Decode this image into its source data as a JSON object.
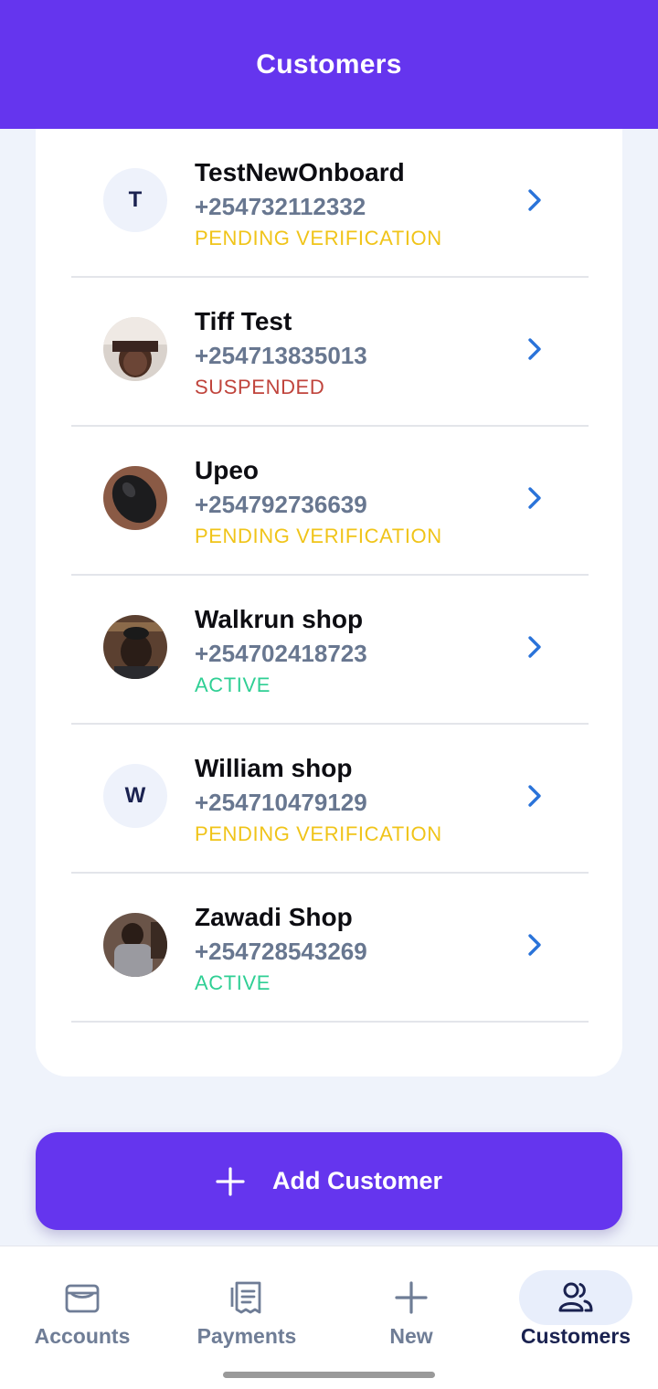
{
  "header": {
    "title": "Customers"
  },
  "colors": {
    "brand": "#6535ee",
    "pending": "#f0c419",
    "suspended": "#c0443c",
    "active": "#2fcf94",
    "chevron": "#2a73d9"
  },
  "customers": [
    {
      "name": "TestNewOnboard",
      "phone": "+254732112332",
      "status": "PENDING VERIFICATION",
      "status_color": "#f0c419",
      "avatar": {
        "type": "initial",
        "letter": "T"
      }
    },
    {
      "name": "Tiff Test",
      "phone": "+254713835013",
      "status": "SUSPENDED",
      "status_color": "#c0443c",
      "avatar": {
        "type": "photo",
        "icon": "person-photo-icon"
      }
    },
    {
      "name": "Upeo",
      "phone": "+254792736639",
      "status": "PENDING VERIFICATION",
      "status_color": "#f0c419",
      "avatar": {
        "type": "photo",
        "icon": "mouse-photo-icon"
      }
    },
    {
      "name": "Walkrun shop",
      "phone": "+254702418723",
      "status": "ACTIVE",
      "status_color": "#2fcf94",
      "avatar": {
        "type": "photo",
        "icon": "person-photo-icon"
      }
    },
    {
      "name": "William shop",
      "phone": "+254710479129",
      "status": "PENDING VERIFICATION",
      "status_color": "#f0c419",
      "avatar": {
        "type": "initial",
        "letter": "W"
      }
    },
    {
      "name": "Zawadi Shop",
      "phone": "+254728543269",
      "status": "ACTIVE",
      "status_color": "#2fcf94",
      "avatar": {
        "type": "photo",
        "icon": "person-photo-icon"
      }
    }
  ],
  "add_button": {
    "label": "Add Customer",
    "icon": "plus-icon"
  },
  "bottom_nav": {
    "active": "Customers",
    "items": [
      {
        "label": "Accounts",
        "icon": "wallet-icon"
      },
      {
        "label": "Payments",
        "icon": "receipt-icon"
      },
      {
        "label": "New",
        "icon": "plus-icon"
      },
      {
        "label": "Customers",
        "icon": "users-icon"
      }
    ]
  }
}
